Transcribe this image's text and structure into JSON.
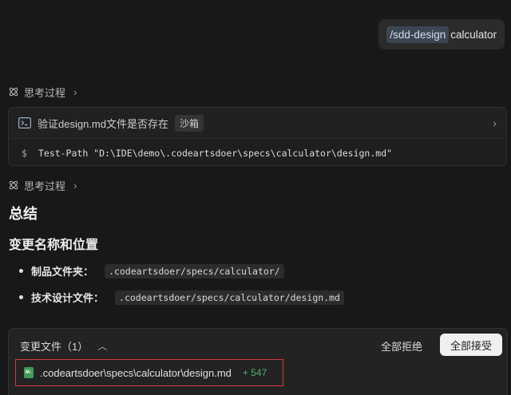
{
  "user_message": {
    "command": "/sdd-design",
    "argument": "calculator"
  },
  "thinking": {
    "label": "思考过程"
  },
  "tool_card": {
    "title": "验证design.md文件是否存在",
    "badge": "沙箱",
    "prompt_symbol": "$",
    "command": "Test-Path \"D:\\IDE\\demo\\.codeartsdoer\\specs\\calculator\\design.md\""
  },
  "summary": {
    "heading": "总结",
    "subheading": "变更名称和位置",
    "items": [
      {
        "label": "制品文件夹：",
        "value": ".codeartsdoer/specs/calculator/"
      },
      {
        "label": "技术设计文件：",
        "value": ".codeartsdoer/specs/calculator/design.md"
      }
    ]
  },
  "changes": {
    "title": "变更文件（1）",
    "reject_all": "全部拒绝",
    "accept_all": "全部接受",
    "files": [
      {
        "icon_text": "M↓",
        "path": ".codeartsdoer\\specs\\calculator\\design.md",
        "added": "+ 547"
      }
    ]
  },
  "colors": {
    "background": "#181818",
    "accent_green": "#4fb06b",
    "highlight_red": "#d13b3b"
  }
}
